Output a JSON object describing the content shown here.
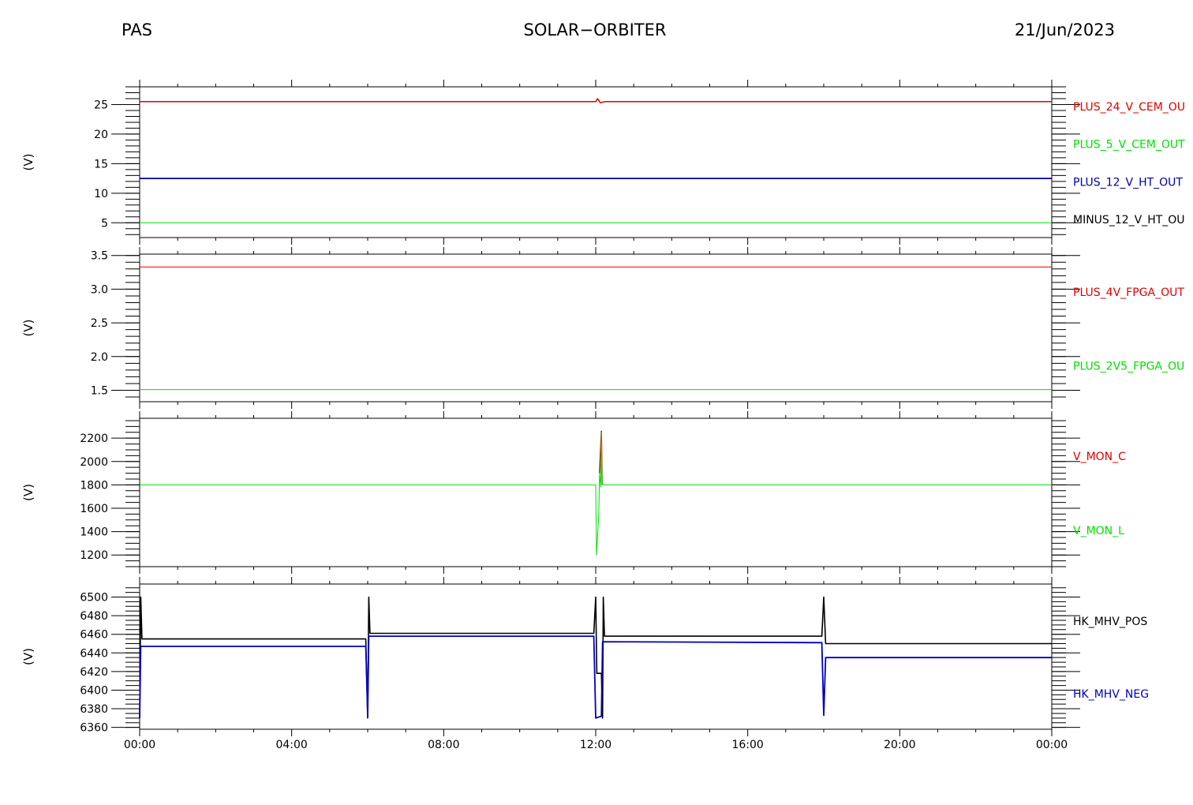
{
  "header": {
    "left": "PAS",
    "center": "SOLAR−ORBITER",
    "right": "21/Jun/2023"
  },
  "x_ticks": [
    "00:00",
    "04:00",
    "08:00",
    "12:00",
    "16:00",
    "20:00",
    "00:00"
  ],
  "chart_data": [
    {
      "type": "line",
      "ylabel": "(V)",
      "ylim": [
        2.5,
        28.0
      ],
      "yticks": [
        5,
        10,
        15,
        20,
        25
      ],
      "ytick_labels": [
        "5",
        "10",
        "15",
        "20",
        "25"
      ],
      "minor_step": 1,
      "x_range_hours": [
        0,
        24
      ],
      "series": [
        {
          "name": "PLUS_24_V_CEM_OUT",
          "label": "PLUS_24_V_CEM_OU",
          "color": "#e00000",
          "width": 1.5,
          "points": [
            [
              0,
              25.5
            ],
            [
              12.0,
              25.5
            ],
            [
              12.05,
              26.0
            ],
            [
              12.12,
              25.3
            ],
            [
              12.25,
              25.5
            ],
            [
              24,
              25.5
            ]
          ]
        },
        {
          "name": "PLUS_5_V_CEM_OUT",
          "label": "PLUS_5_V_CEM_OUT",
          "color": "#00e000",
          "width": 1,
          "points": [
            [
              0,
              5.0
            ],
            [
              24,
              5.0
            ]
          ]
        },
        {
          "name": "PLUS_12_V_HT_OUT",
          "label": "PLUS_12_V_HT_OUT",
          "color": "#0000a0",
          "width": 1.8,
          "points": [
            [
              0,
              12.5
            ],
            [
              24,
              12.5
            ]
          ]
        },
        {
          "name": "MINUS_12_V_HT_OUT",
          "label": "MINUS_12_V_HT_OU",
          "color": "#000000",
          "width": 0,
          "points": []
        }
      ]
    },
    {
      "type": "line",
      "ylabel": "(V)",
      "ylim": [
        1.33,
        3.52
      ],
      "yticks": [
        1.5,
        2.0,
        2.5,
        3.0,
        3.5
      ],
      "ytick_labels": [
        "1.5",
        "2.0",
        "2.5",
        "3.0",
        "3.5"
      ],
      "minor_step": 0.1,
      "x_range_hours": [
        0,
        24
      ],
      "series": [
        {
          "name": "PLUS_4V_FPGA_OUT",
          "label": "PLUS_4V_FPGA_OUT",
          "color": "#e00000",
          "width": 1,
          "points": [
            [
              0,
              3.33
            ],
            [
              24,
              3.33
            ]
          ]
        },
        {
          "name": "PLUS_2V5_FPGA_OUT",
          "label": "PLUS_2V5_FPGA_OU",
          "color": "#00e000",
          "width": 1,
          "points": [
            [
              0,
              1.51
            ],
            [
              24,
              1.51
            ]
          ]
        }
      ]
    },
    {
      "type": "line",
      "ylabel": "(V)",
      "ylim": [
        1100,
        2370
      ],
      "yticks": [
        1200,
        1400,
        1600,
        1800,
        2000,
        2200
      ],
      "ytick_labels": [
        "1200",
        "1400",
        "1600",
        "1800",
        "2000",
        "2200"
      ],
      "minor_step": 50,
      "x_range_hours": [
        0,
        24
      ],
      "series": [
        {
          "name": "V_MON_C",
          "label": "V_MON_C",
          "color": "#e00000",
          "width": 1.5,
          "points": [
            [
              12.1,
              1900
            ],
            [
              12.15,
              2260
            ],
            [
              12.17,
              1800
            ]
          ]
        },
        {
          "name": "V_MON_L",
          "label": "V_MON_L",
          "color": "#00e000",
          "width": 1,
          "points": [
            [
              0,
              1800
            ],
            [
              12.0,
              1800
            ],
            [
              12.02,
              1200
            ],
            [
              12.08,
              1550
            ],
            [
              12.1,
              1900
            ],
            [
              12.13,
              1780
            ],
            [
              12.15,
              2250
            ],
            [
              12.17,
              1800
            ],
            [
              24,
              1800
            ]
          ]
        }
      ]
    },
    {
      "type": "line",
      "ylabel": "(V)",
      "ylim": [
        6358,
        6514
      ],
      "yticks": [
        6360,
        6380,
        6400,
        6420,
        6440,
        6460,
        6480,
        6500
      ],
      "ytick_labels": [
        "6360",
        "6380",
        "6400",
        "6420",
        "6440",
        "6460",
        "6480",
        "6500"
      ],
      "minor_step": 5,
      "x_range_hours": [
        0,
        24
      ],
      "series": [
        {
          "name": "HK_MHV_POS",
          "label": "HK_MHV_POS",
          "color": "#000000",
          "width": 1.6,
          "points": [
            [
              0,
              6370
            ],
            [
              0.03,
              6500
            ],
            [
              0.06,
              6455
            ],
            [
              5.95,
              6455
            ],
            [
              6.0,
              6370
            ],
            [
              6.03,
              6500
            ],
            [
              6.06,
              6461
            ],
            [
              11.95,
              6461
            ],
            [
              12.0,
              6500
            ],
            [
              12.03,
              6418
            ],
            [
              12.15,
              6418
            ],
            [
              12.18,
              6370
            ],
            [
              12.2,
              6500
            ],
            [
              12.23,
              6458
            ],
            [
              17.95,
              6458
            ],
            [
              18.0,
              6500
            ],
            [
              18.05,
              6450
            ],
            [
              24,
              6450
            ]
          ]
        },
        {
          "name": "HK_MHV_NEG",
          "label": "HK_MHV_NEG",
          "color": "#0000c0",
          "width": 1.8,
          "points": [
            [
              0,
              6370
            ],
            [
              0.03,
              6447
            ],
            [
              5.95,
              6447
            ],
            [
              6.0,
              6372
            ],
            [
              6.03,
              6458
            ],
            [
              11.95,
              6458
            ],
            [
              12.0,
              6370
            ],
            [
              12.15,
              6372
            ],
            [
              12.18,
              6452
            ],
            [
              17.95,
              6451
            ],
            [
              18.0,
              6373
            ],
            [
              18.05,
              6435
            ],
            [
              24,
              6435
            ]
          ]
        }
      ]
    }
  ]
}
